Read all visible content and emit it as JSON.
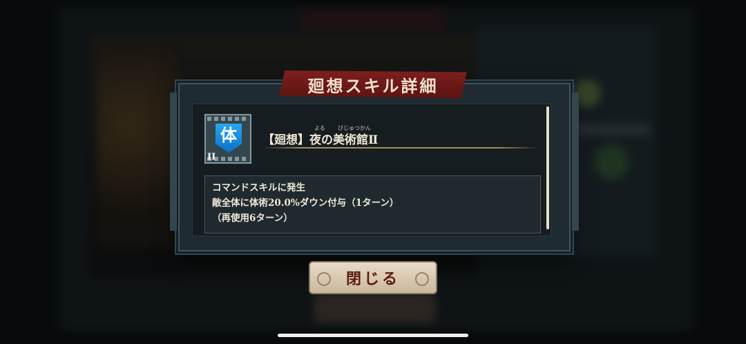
{
  "background": {
    "title": ""
  },
  "dialog": {
    "title": "廻想スキル詳細",
    "skill": {
      "icon_glyph": "体",
      "icon_name": "body-attribute-shield-icon",
      "icon_color": "#1a8ee0",
      "rank": "II",
      "name": "【廻想】夜の美術館Ⅱ",
      "ruby_yoru": "よる",
      "ruby_bijutsukan": "びじゅつかん"
    },
    "description": [
      "コマンドスキルに発生",
      "敵全体に体術20.0%ダウン付与（1ターン）",
      "（再使用6ターン）"
    ],
    "close_label": "閉じる"
  },
  "colors": {
    "banner": "#7d1f1d",
    "accent_gold": "#a88f58",
    "button_text": "#5a1b14"
  }
}
